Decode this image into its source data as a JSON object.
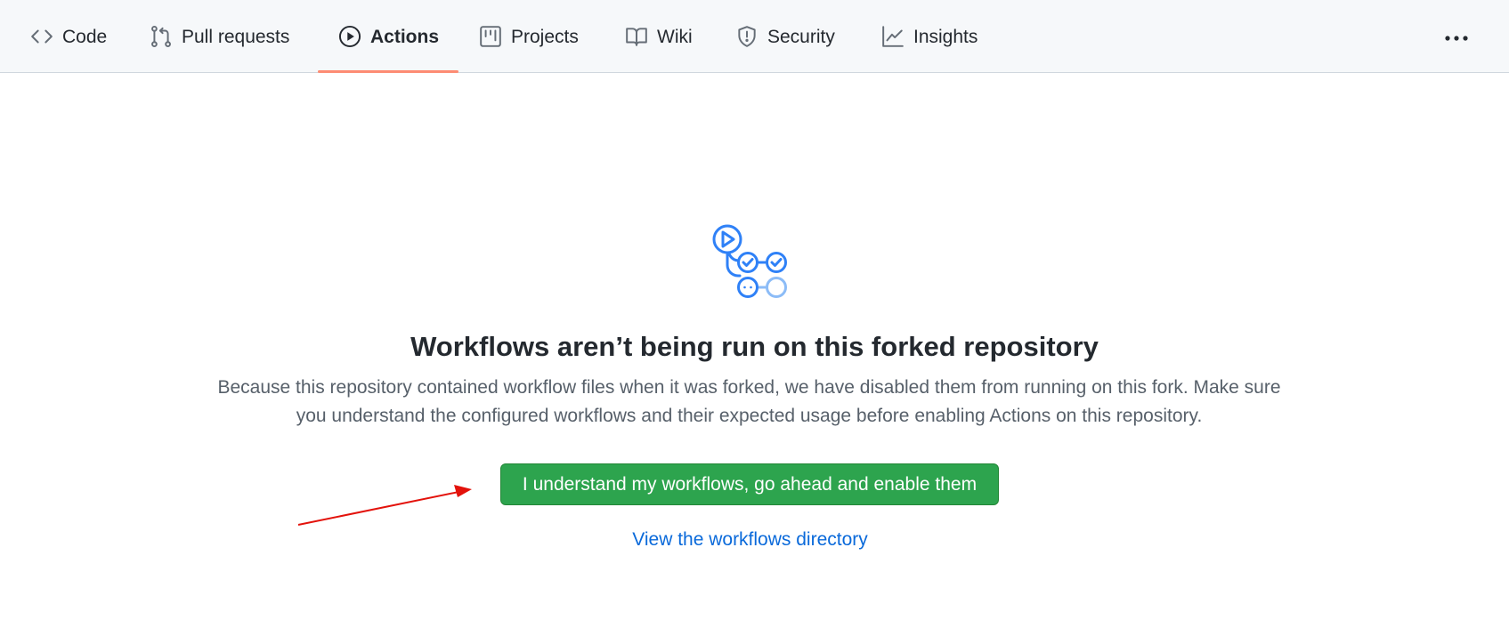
{
  "nav": {
    "tabs": [
      {
        "label": "Code",
        "icon": "code-icon",
        "active": false
      },
      {
        "label": "Pull requests",
        "icon": "git-pull-request-icon",
        "active": false
      },
      {
        "label": "Actions",
        "icon": "play-icon",
        "active": true
      },
      {
        "label": "Projects",
        "icon": "project-board-icon",
        "active": false
      },
      {
        "label": "Wiki",
        "icon": "book-icon",
        "active": false
      },
      {
        "label": "Security",
        "icon": "shield-icon",
        "active": false
      },
      {
        "label": "Insights",
        "icon": "graph-icon",
        "active": false
      }
    ],
    "more_icon": "kebab-horizontal-icon",
    "active_underline_color": "#fd8c73"
  },
  "main": {
    "illustration": "workflow-icon",
    "title": "Workflows aren’t being run on this forked repository",
    "description": "Because this repository contained workflow files when it was forked, we have disabled them from running on this fork. Make sure you understand the configured workflows and their expected usage before enabling Actions on this repository.",
    "enable_button_label": "I understand my workflows, go ahead and enable them",
    "directory_link_label": "View the workflows directory"
  },
  "colors": {
    "primary_button": "#2da44e",
    "link": "#0969da",
    "illustration_blue": "#2f81f7",
    "annotation_arrow": "#e3120b"
  }
}
